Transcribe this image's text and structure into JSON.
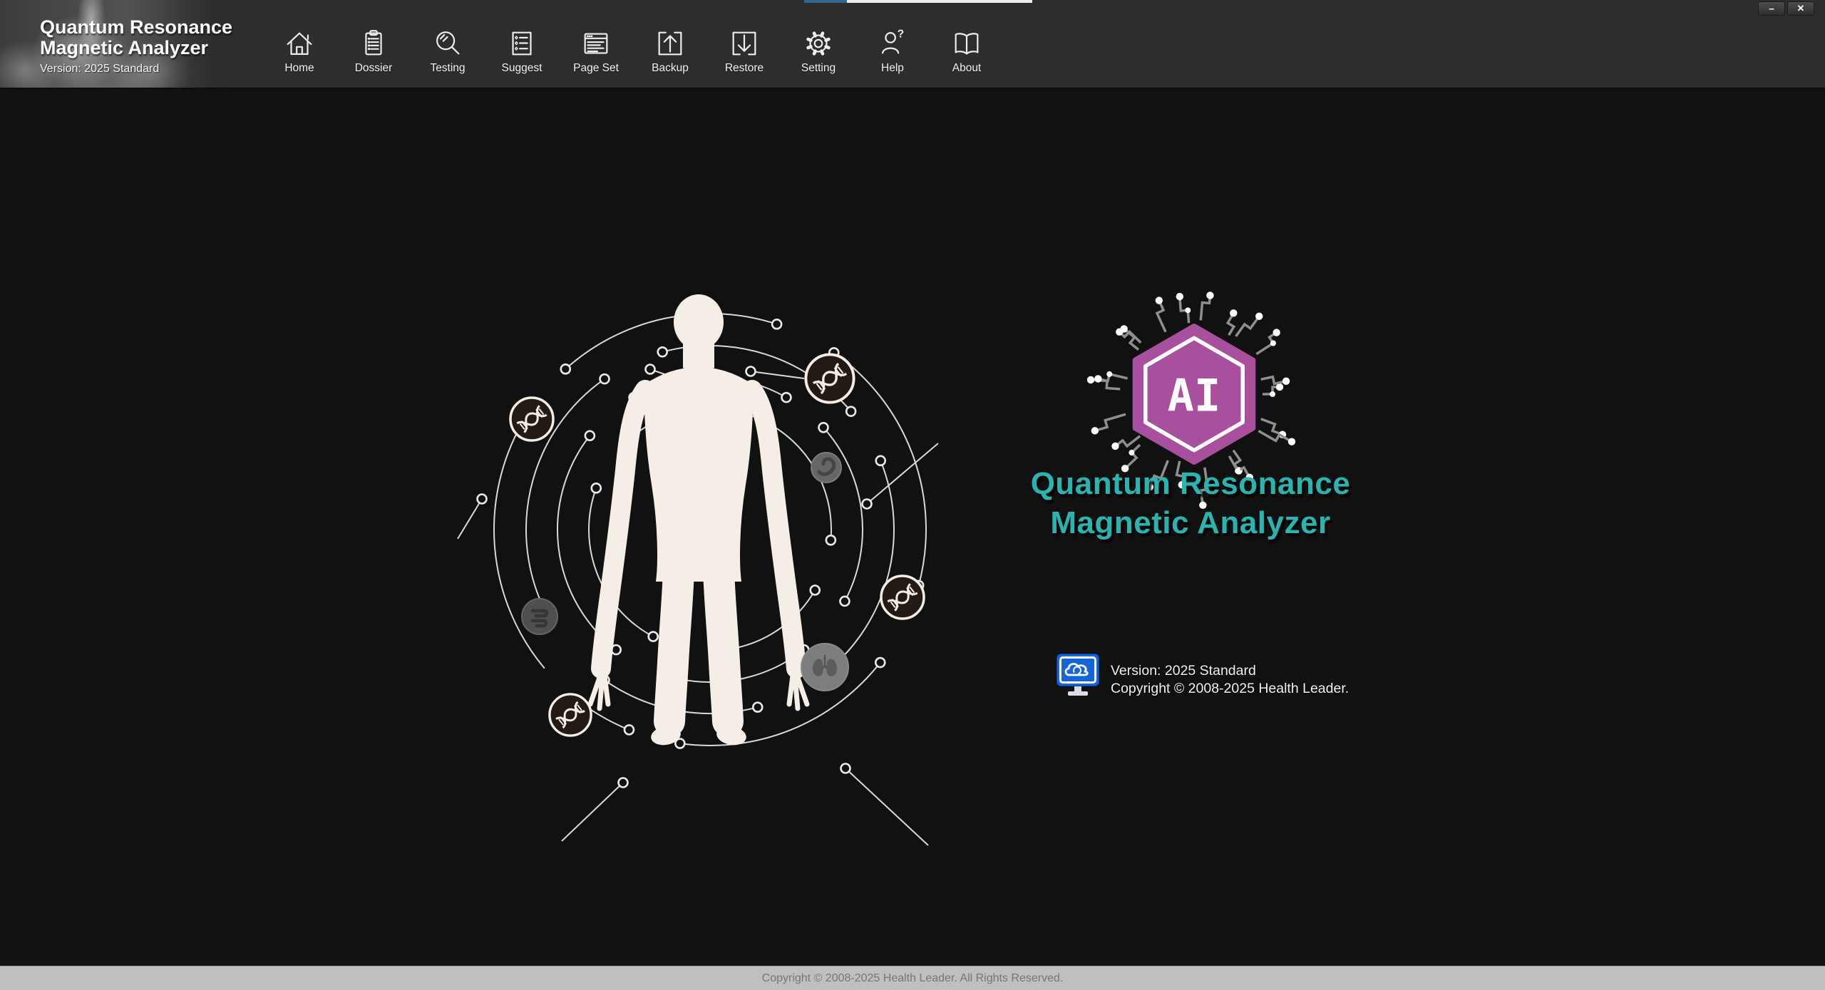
{
  "brand": {
    "title_line1": "Quantum Resonance",
    "title_line2": "Magnetic Analyzer",
    "version": "Version: 2025 Standard"
  },
  "window_controls": {
    "minimize": "−",
    "close": "✕"
  },
  "toolbar": {
    "items": [
      {
        "label": "Home"
      },
      {
        "label": "Dossier"
      },
      {
        "label": "Testing"
      },
      {
        "label": "Suggest"
      },
      {
        "label": "Page Set"
      },
      {
        "label": "Backup"
      },
      {
        "label": "Restore"
      },
      {
        "label": "Setting"
      },
      {
        "label": "Help"
      },
      {
        "label": "About"
      }
    ]
  },
  "hero": {
    "ai_monogram": "AI",
    "title_line1": "Quantum Resonance",
    "title_line2": "Magnetic Analyzer",
    "version_line": "Version: 2025 Standard",
    "copyright_line": "Copyright © 2008-2025 Health Leader."
  },
  "status_bar": {
    "text": "Copyright © 2008-2025 Health Leader. All Rights Reserved."
  },
  "colors": {
    "accent_teal": "#2ab4af",
    "accent_magenta": "#a84f9e",
    "monitor_blue": "#1565d8",
    "progress_blue": "#31688f",
    "progress_track": "#ececec",
    "status_bar_bg": "#bfbfbf"
  }
}
